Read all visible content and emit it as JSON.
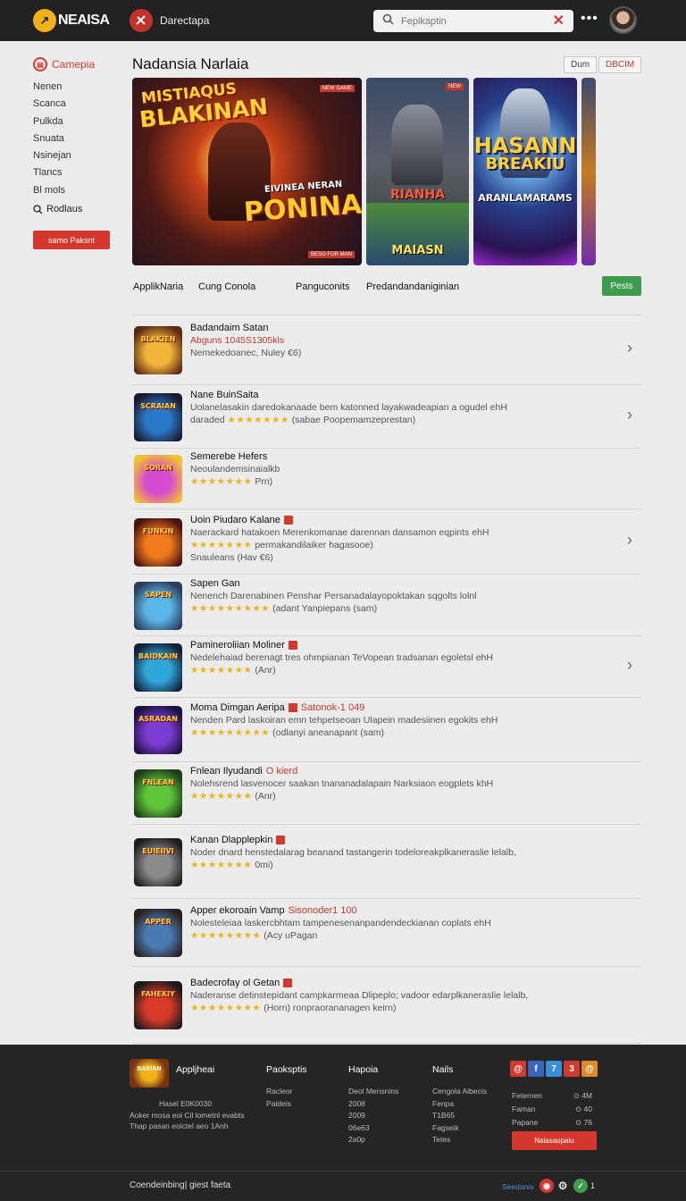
{
  "header": {
    "brand": "NEAISA",
    "app_name": "Darectapa",
    "search_placeholder": "Fepikaptin",
    "more": "•••"
  },
  "sidebar": {
    "heading": "Camepia",
    "items": [
      "Nenen",
      "Scanca",
      "Pulkda",
      "Snuata",
      "Nsinejan",
      "Tlancs",
      "Bl mols"
    ],
    "search_label": "Rodlaus",
    "button": "samo Paksnt"
  },
  "main": {
    "title": "Nadansia Narlaia",
    "chip_1": "Dum",
    "chip_2": "DBCIM",
    "banners": [
      {
        "tag": "NEW GAME",
        "line1": "MISTIAQUS",
        "line2": "BLAKINAN",
        "line3": "EIVINEA NERAN",
        "line4": "PONINA!!",
        "corner": "BESO FOR MAN"
      },
      {
        "tag": "NEW",
        "line1": "RIANHA",
        "line2": "MAIASN"
      },
      {
        "line1": "HASANN",
        "line2": "BREAKIU",
        "line3": "ARANLAMARAMS"
      }
    ],
    "tabs": [
      "ApplikNaria",
      "Cung Conola",
      "Panguconits",
      "Predandandaniginian"
    ],
    "tabs_button": "Pests"
  },
  "list": [
    {
      "title": "Badandaim Satan",
      "line1": "Abguns 1045S1305kls",
      "line2": "Nemekedoanec, Nuley €6)",
      "thumb": "BLAKIEN",
      "colors": [
        "#f2b43b",
        "#5a2a14"
      ],
      "chevron": true
    },
    {
      "title": "Nane BuinSaita",
      "line1": "Uolanelasakin daredokanaade bem katonned layakwadeapian a ogudel ehH",
      "line2_prefix": "daraded",
      "stars": "★★★★★★★",
      "line2": "(sabae Poopemamzeprestan)",
      "thumb": "SCRAIAN",
      "colors": [
        "#2a78c8",
        "#1a1a2e"
      ],
      "chevron": true
    },
    {
      "title": "Semerebe Hefers",
      "line1": "Neoulandemsinaialkb",
      "stars": "★★★★★★★",
      "line2": "Prn)",
      "thumb": "SORAN",
      "colors": [
        "#d64bd0",
        "#f2c12e"
      ],
      "chevron": false
    },
    {
      "title": "Uoin Piudaro Kalane",
      "line1": "Naerackard hatakoen Merenkomanae darennan dansamon eqpints ehH",
      "stars": "★★★★★★★",
      "line2": "permakandilaiker hagasooe)",
      "line3": "Snauleans (Hav €6)",
      "thumb": "FUNKIN",
      "colors": [
        "#f07b1d",
        "#4a1410"
      ],
      "chevron": true,
      "badge": true
    },
    {
      "title": "Sapen Gan",
      "line1": "Nenench Darenabinen Penshar Persanadalayopoktakan sqgolts lolnl",
      "stars": "★★★★★★★★★",
      "line2": "(adant Yanpiepans (sam)",
      "thumb": "SAPEN",
      "colors": [
        "#5ab6e8",
        "#2a3d5c"
      ],
      "chevron": false
    },
    {
      "title": "Pamineroliian Moliner",
      "line1": "Nedelehaiad berenagt tres ohmpianan TeVopean tradsanan egoletsl ehH",
      "stars": "★★★★★★★",
      "line2": "(Anr)",
      "thumb": "BAIDKAIN",
      "colors": [
        "#2fa6d8",
        "#122038"
      ],
      "chevron": true,
      "badge": true
    },
    {
      "title": "Moma Dimgan Aeripa",
      "highlight": "Satonok-1 049",
      "line1": "Nenden Pard laskoiran emn tehpetseoan Ulapein madesiinen egokits ehH",
      "stars": "★★★★★★★★★",
      "line2": "(odlanyi aneanapant (sam)",
      "thumb": "ASRADAN",
      "colors": [
        "#7a3bd0",
        "#1c1240"
      ],
      "chevron": false,
      "badge": true
    },
    {
      "title": "Fnlean Ilyudandi",
      "highlight": "O kierd",
      "line1": "Nolehsrend lasvenocer saakan tnananadalapain Narksiaon eogplets khH",
      "stars": "★★★★★★★",
      "line2": "(Anr)",
      "thumb": "FNLEAN",
      "colors": [
        "#5ec43a",
        "#1e3d18"
      ],
      "chevron": false
    },
    {
      "title": "Kanan Dlapplepkin",
      "line1": "Noder dnard henstedalarag beanand tastangerin todeloreakplkaneraslie lelalb,",
      "stars": "★★★★★★★",
      "line2": "0mi)",
      "thumb": "EUIEIIVI",
      "colors": [
        "#8a8a8a",
        "#1e1e1e"
      ],
      "chevron": false,
      "badge": true
    },
    {
      "title": "Apper ekoroain Vamp",
      "highlight": "Sisonoder1 100",
      "line1": "Nolesteleiaa laskercbhtam tampenesenanpandendeckianan coplats ehH",
      "stars": "★★★★★★★★",
      "line2": "(Acy uPagan",
      "thumb": "APPER",
      "colors": [
        "#4a7ab0",
        "#2a2020"
      ],
      "chevron": false
    },
    {
      "title": "Badecrofay ol Getan",
      "line1": "Naderanse detinstepidant campkarmeaa Dlipeplo; vadoor edarplkaneraslie lelalb,",
      "stars": "★★★★★★★★",
      "line2": "(Horn) ronpraorananagen keirn)",
      "thumb": "FAHEKIY",
      "colors": [
        "#d83a2a",
        "#1a1a1a"
      ],
      "chevron": false,
      "badge": true
    }
  ],
  "footer": {
    "logo_text": "BAKIAN",
    "brand": "Appljheai",
    "lines": [
      "Hasel E0K0030",
      "Aoker mosa eoi Cil lometnl evabts",
      "Thap pasan eoictel aeo 1Anh"
    ],
    "col1": {
      "head": "Paoksptis",
      "links": [
        "Racleor",
        "Paldeis"
      ]
    },
    "col2": {
      "head": "Hapoia",
      "links": [
        "Deol Mensnins",
        "2008",
        "2009",
        "06e63",
        "2a0p"
      ]
    },
    "col3": {
      "head": "Nails",
      "links": [
        "Cengola Aibecis",
        "Fenpa",
        "T1B65",
        "Fagseik",
        "Tetes"
      ]
    },
    "socials": [
      "@",
      "f",
      "7",
      "3",
      "@"
    ],
    "social_colors": [
      "#d23a2f",
      "#3a66b8",
      "#3a8ed6",
      "#d23a2f",
      "#e0892a"
    ],
    "stats": [
      {
        "label": "Feternen",
        "value": "⊙ 4M"
      },
      {
        "label": "Faman",
        "value": "⊙ 40"
      },
      {
        "label": "Papane",
        "value": "⊙ 76"
      }
    ],
    "button": "Nalasaupaiu",
    "copyright": "Coendeinbing| giest faeta",
    "lang": "Seedanis",
    "count": "1"
  }
}
